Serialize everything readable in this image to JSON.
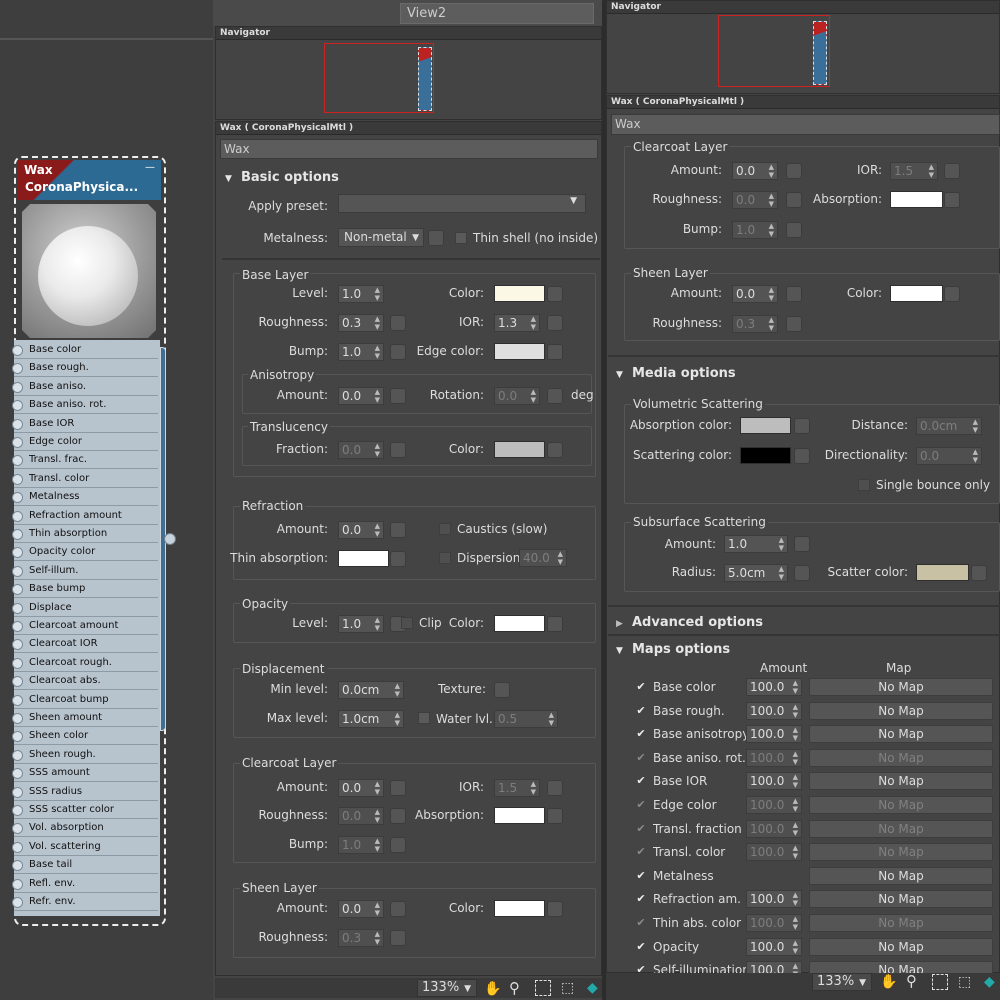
{
  "view_tab": "View2",
  "node": {
    "title_line1": "Wax",
    "title_line2": "CoronaPhysica...",
    "collapse_glyph": "—",
    "sockets": [
      "Base color",
      "Base rough.",
      "Base aniso.",
      "Base aniso. rot.",
      "Base IOR",
      "Edge color",
      "Transl. frac.",
      "Transl. color",
      "Metalness",
      "Refraction amount",
      "Thin absorption",
      "Opacity color",
      "Self-illum.",
      "Base bump",
      "Displace",
      "Clearcoat amount",
      "Clearcoat IOR",
      "Clearcoat rough.",
      "Clearcoat abs.",
      "Clearcoat bump",
      "Sheen amount",
      "Sheen color",
      "Sheen rough.",
      "SSS amount",
      "SSS radius",
      "SSS scatter color",
      "Vol. absorption",
      "Vol. scattering",
      "Base tail",
      "Refl. env.",
      "Refr. env."
    ]
  },
  "left_panel": {
    "navigator_title": "Navigator",
    "material_title": "Wax  ( CoronaPhysicalMtl )",
    "name_field": "Wax",
    "basic_options": "Basic options",
    "apply_preset": "Apply preset:",
    "metalness_label": "Metalness:",
    "metalness_value": "Non-metal",
    "thin_shell": "Thin shell (no inside)",
    "base_layer": "Base Layer",
    "level": "Level:",
    "level_val": "1.0",
    "color": "Color:",
    "roughness": "Roughness:",
    "roughness_val": "0.3",
    "ior": "IOR:",
    "ior_val": "1.3",
    "bump": "Bump:",
    "bump_val": "1.0",
    "edge_color": "Edge color:",
    "anisotropy": "Anisotropy",
    "amount": "Amount:",
    "aniso_amount": "0.0",
    "rotation": "Rotation:",
    "rotation_val": "0.0",
    "deg": "deg",
    "translucency": "Translucency",
    "fraction": "Fraction:",
    "fraction_val": "0.0",
    "refraction": "Refraction",
    "refr_amount": "0.0",
    "caustics": "Caustics (slow)",
    "thin_absorption": "Thin absorption:",
    "dispersion": "Dispersion",
    "dispersion_val": "40.0",
    "opacity": "Opacity",
    "opacity_level": "1.0",
    "clip": "Clip",
    "displacement": "Displacement",
    "min_level": "Min level:",
    "min_level_val": "0.0cm",
    "texture": "Texture:",
    "max_level": "Max level:",
    "max_level_val": "1.0cm",
    "water_lvl": "Water lvl.",
    "water_lvl_val": "0.5",
    "clearcoat": "Clearcoat Layer",
    "cc_amount": "0.0",
    "cc_ior": "1.5",
    "cc_rough": "0.0",
    "cc_bump": "1.0",
    "absorption": "Absorption:",
    "sheen": "Sheen Layer",
    "sheen_amount": "0.0",
    "sheen_rough": "0.3",
    "zoom": "133%"
  },
  "right_panel": {
    "navigator_title": "Navigator",
    "material_title": "Wax  ( CoronaPhysicalMtl )",
    "name_field": "Wax",
    "clearcoat": "Clearcoat Layer",
    "amount": "Amount:",
    "cc_amount": "0.0",
    "ior": "IOR:",
    "cc_ior": "1.5",
    "roughness": "Roughness:",
    "cc_rough": "0.0",
    "absorption": "Absorption:",
    "bump": "Bump:",
    "cc_bump": "1.0",
    "sheen": "Sheen Layer",
    "sheen_amount": "0.0",
    "color": "Color:",
    "sheen_rough": "0.3",
    "media_options": "Media options",
    "vol_scattering": "Volumetric Scattering",
    "absorption_color": "Absorption color:",
    "distance": "Distance:",
    "distance_val": "0.0cm",
    "scattering_color": "Scattering color:",
    "directionality": "Directionality:",
    "directionality_val": "0.0",
    "single_bounce": "Single bounce only",
    "sss": "Subsurface Scattering",
    "sss_amount": "1.0",
    "radius": "Radius:",
    "radius_val": "5.0cm",
    "scatter_color": "Scatter color:",
    "advanced_options": "Advanced options",
    "maps_options": "Maps options",
    "col_amount": "Amount",
    "col_map": "Map",
    "maps": [
      {
        "name": "Base color",
        "amount": "100.0",
        "map": "No Map",
        "enabled": true
      },
      {
        "name": "Base rough.",
        "amount": "100.0",
        "map": "No Map",
        "enabled": true
      },
      {
        "name": "Base anisotropy",
        "amount": "100.0",
        "map": "No Map",
        "enabled": true
      },
      {
        "name": "Base aniso. rot.",
        "amount": "100.0",
        "map": "No Map",
        "enabled": false
      },
      {
        "name": "Base IOR",
        "amount": "100.0",
        "map": "No Map",
        "enabled": true
      },
      {
        "name": "Edge color",
        "amount": "100.0",
        "map": "No Map",
        "enabled": false
      },
      {
        "name": "Transl. fraction",
        "amount": "100.0",
        "map": "No Map",
        "enabled": false
      },
      {
        "name": "Transl. color",
        "amount": "100.0",
        "map": "No Map",
        "enabled": false
      },
      {
        "name": "Metalness",
        "amount": "",
        "map": "No Map",
        "enabled": true
      },
      {
        "name": "Refraction am.",
        "amount": "100.0",
        "map": "No Map",
        "enabled": true
      },
      {
        "name": "Thin abs. color",
        "amount": "100.0",
        "map": "No Map",
        "enabled": false
      },
      {
        "name": "Opacity",
        "amount": "100.0",
        "map": "No Map",
        "enabled": true
      },
      {
        "name": "Self-illumination",
        "amount": "100.0",
        "map": "No Map",
        "enabled": true
      }
    ],
    "zoom": "133%"
  },
  "colors": {
    "base_color": "#fcf8e6",
    "edge_color": "#e0e0e0",
    "transl_color": "#bdbdbd",
    "white": "#ffffff",
    "absorption_color": "#bdbdbd",
    "scattering_color": "#000000",
    "scatter_color": "#c9c1a4"
  }
}
